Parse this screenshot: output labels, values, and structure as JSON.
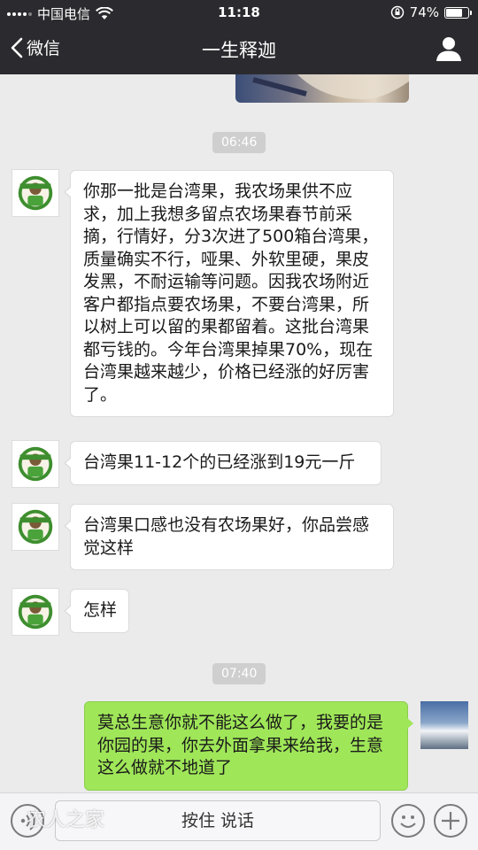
{
  "status_bar": {
    "carrier": "中国电信",
    "time": "11:18",
    "battery": "74%",
    "battery_level": 0.74
  },
  "nav": {
    "back_label": "微信",
    "title": "一生释迦"
  },
  "chat": {
    "timestamps": [
      "06:46",
      "07:40"
    ],
    "messages": [
      {
        "side": "left",
        "text": "你那一批是台湾果，我农场果供不应求，加上我想多留点农场果春节前采摘，行情好，分3次进了500箱台湾果，质量确实不行，哑果、外软里硬，果皮发黑，不耐运输等问题。因我农场附近客户都指点要农场果，不要台湾果，所以树上可以留的果都留着。这批台湾果都亏钱的。今年台湾果掉果70%，现在台湾果越来越少，价格已经涨的好厉害了。"
      },
      {
        "side": "left",
        "text": "台湾果11-12个的已经涨到19元一斤"
      },
      {
        "side": "left",
        "text": "台湾果口感也没有农场果好，你品尝感觉这样"
      },
      {
        "side": "left",
        "text": "怎样"
      },
      {
        "side": "right",
        "text": "莫总生意你就不能这么做了，我要的是你园的果，你去外面拿果来给我，生意这么做就不地道了"
      }
    ]
  },
  "input_bar": {
    "voice_label": "按住 说话",
    "watermark": "农人之家"
  },
  "colors": {
    "bar_bg": "#2b2b2f",
    "chat_bg": "#ebebeb",
    "right_bubble": "#9fe658",
    "time_chip": "#cfcfcf"
  },
  "icons": [
    "signal-icon",
    "wifi-icon",
    "rotation-lock-icon",
    "battery-icon",
    "back-chevron-icon",
    "profile-icon",
    "voice-icon",
    "emoji-icon",
    "plus-icon"
  ]
}
